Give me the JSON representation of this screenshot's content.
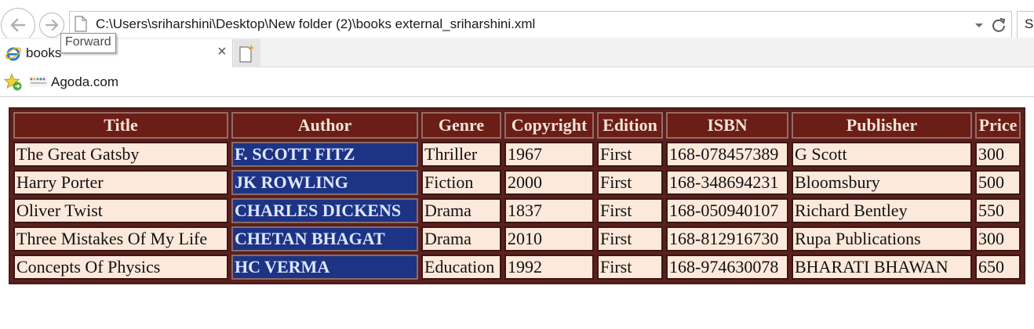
{
  "browser": {
    "address": "C:\\Users\\sriharshini\\Desktop\\New folder (2)\\books external_sriharshini.xml",
    "search_partial": "Se",
    "tooltip": "Forward",
    "tab_title": "books",
    "tab_close": "×",
    "favorites": [
      {
        "label": "Agoda.com"
      }
    ]
  },
  "table": {
    "headers": [
      "Title",
      "Author",
      "Genre",
      "Copyright",
      "Edition",
      "ISBN",
      "Publisher",
      "Price"
    ],
    "rows": [
      [
        "The Great Gatsby",
        "F. SCOTT FITZ",
        "Thriller",
        "1967",
        "First",
        "168-078457389",
        "G Scott",
        "300"
      ],
      [
        "Harry Porter",
        "JK ROWLING",
        "Fiction",
        "2000",
        "First",
        "168-348694231",
        "Bloomsbury",
        "500"
      ],
      [
        "Oliver Twist",
        "CHARLES DICKENS",
        "Drama",
        "1837",
        "First",
        "168-050940107",
        "Richard Bentley",
        "550"
      ],
      [
        "Three Mistakes Of My Life",
        "CHETAN BHAGAT",
        "Drama",
        "2010",
        "First",
        "168-812916730",
        "Rupa Publications",
        "300"
      ],
      [
        "Concepts Of Physics",
        "HC VERMA",
        "Education",
        "1992",
        "First",
        "168-974630078",
        "BHARATI BHAWAN",
        "650"
      ]
    ]
  },
  "colors": {
    "header_bg": "#6b1e16",
    "header_text": "#f3e3d8",
    "cell_bg": "#fde9dc",
    "author_bg": "#1d3485",
    "author_text": "#dfe6ff",
    "table_frame": "#5a201d"
  },
  "icons": {
    "back": "back-arrow-icon",
    "forward": "forward-arrow-icon",
    "page": "page-icon",
    "dropdown": "chevron-down-icon",
    "refresh": "refresh-icon",
    "tab": "ie-logo-icon",
    "new_tab": "new-tab-icon",
    "favorites": "favorites-star-icon",
    "fav_link": "agoda-icon"
  }
}
